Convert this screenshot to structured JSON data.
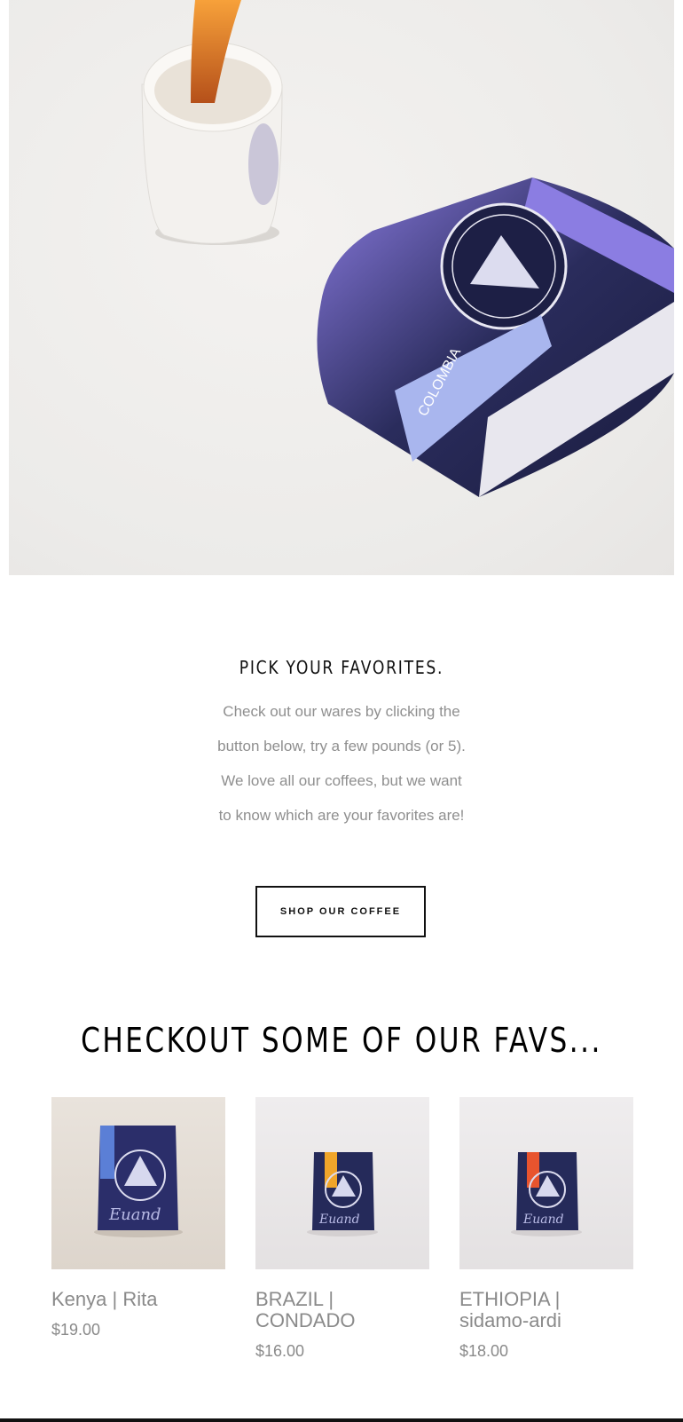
{
  "hero": {
    "image": "coffee-pour-and-bag-photo",
    "bag_label": "COLOMBIA"
  },
  "favorites": {
    "title": "PICK YOUR FAVORITES.",
    "lines": [
      "Check out our wares by clicking the",
      "button below, try a few pounds (or 5).",
      "We love all our coffees, but we want",
      "to know which are your favorites are!"
    ],
    "button_label": "SHOP OUR COFFEE"
  },
  "favs": {
    "title": "CHECKOUT SOME OF OUR FAVS...",
    "products": [
      {
        "name": "Kenya | Rita",
        "price": "$19.00",
        "label_color": "#5b7fd6"
      },
      {
        "name": "BRAZIL | CONDADO",
        "price": "$16.00",
        "label_color": "#f0a52a"
      },
      {
        "name": "ETHIOPIA | sidamo-ardi",
        "price": "$18.00",
        "label_color": "#e8542e"
      }
    ],
    "brand_on_bag": "Euand"
  },
  "colors": {
    "text_dark": "#111111",
    "text_muted": "#8f8f8f",
    "bag_navy": "#262a55",
    "bag_purple": "#7b6fd1"
  }
}
